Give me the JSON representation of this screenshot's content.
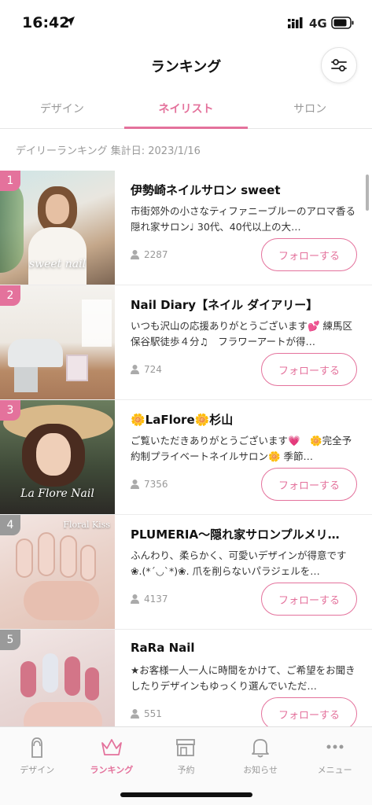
{
  "status": {
    "time": "16:42",
    "network": "4G"
  },
  "header": {
    "title": "ランキング"
  },
  "tabs": [
    {
      "label": "デザイン"
    },
    {
      "label": "ネイリスト"
    },
    {
      "label": "サロン"
    }
  ],
  "ranking_date": "デイリーランキング 集計日: 2023/1/16",
  "follow_label": "フォローする",
  "items": [
    {
      "rank": "1",
      "name": "伊勢崎ネイルサロン sweet",
      "description": "市街郊外の小さなティファニーブルーのアロマ香る隠れ家サロン♩ 30代、40代以上の大…",
      "followers": "2287",
      "photo_caption": "sweet nail"
    },
    {
      "rank": "2",
      "name": "Nail Diary【ネイル ダイアリー】",
      "description": "いつも沢山の応援ありがとうございます💕 練馬区保谷駅徒歩４分♫　フラワーアートが得…",
      "followers": "724",
      "photo_caption": ""
    },
    {
      "rank": "3",
      "name": "🌼LaFlore🌼杉山",
      "description": "ご覧いただきありがとうございます💗　🌼完全予約制プライベートネイルサロン🌼 季節…",
      "followers": "7356",
      "photo_caption": "La Flore Nail"
    },
    {
      "rank": "4",
      "name": "PLUMERIA～隠れ家サロンプルメリ…",
      "description": "ふんわり、柔らかく、可愛いデザインが得意です❀.(*´◡`*)❀. 爪を削らないパラジェルを…",
      "followers": "4137",
      "photo_caption": "Floral Kiss"
    },
    {
      "rank": "5",
      "name": "RaRa Nail",
      "description": "★お客様一人一人に時間をかけて、ご希望をお聞きしたりデザインもゆっくり選んでいただ…",
      "followers": "551",
      "photo_caption": ""
    }
  ],
  "bottom_nav": [
    {
      "label": "デザイン",
      "icon": "nail-icon"
    },
    {
      "label": "ランキング",
      "icon": "crown-icon"
    },
    {
      "label": "予約",
      "icon": "shop-icon"
    },
    {
      "label": "お知らせ",
      "icon": "bell-icon"
    },
    {
      "label": "メニュー",
      "icon": "more-dots-icon"
    }
  ],
  "colors": {
    "accent": "#e4729c",
    "rank_top": "#e4729c",
    "rank_other": "#9a9a9a"
  }
}
